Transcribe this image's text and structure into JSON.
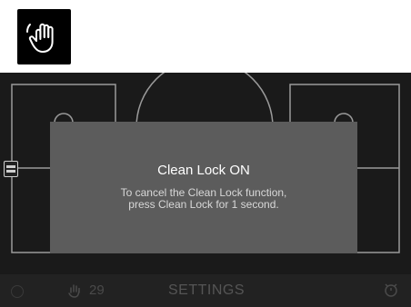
{
  "top_icon": {
    "name": "clean-lock-hand-icon"
  },
  "modal": {
    "title": "Clean Lock ON",
    "line1": "To cancel the Clean Lock function,",
    "line2": "press Clean Lock for 1 second."
  },
  "bottom_bar": {
    "lock_count": "29",
    "settings_label": "SETTINGS"
  }
}
